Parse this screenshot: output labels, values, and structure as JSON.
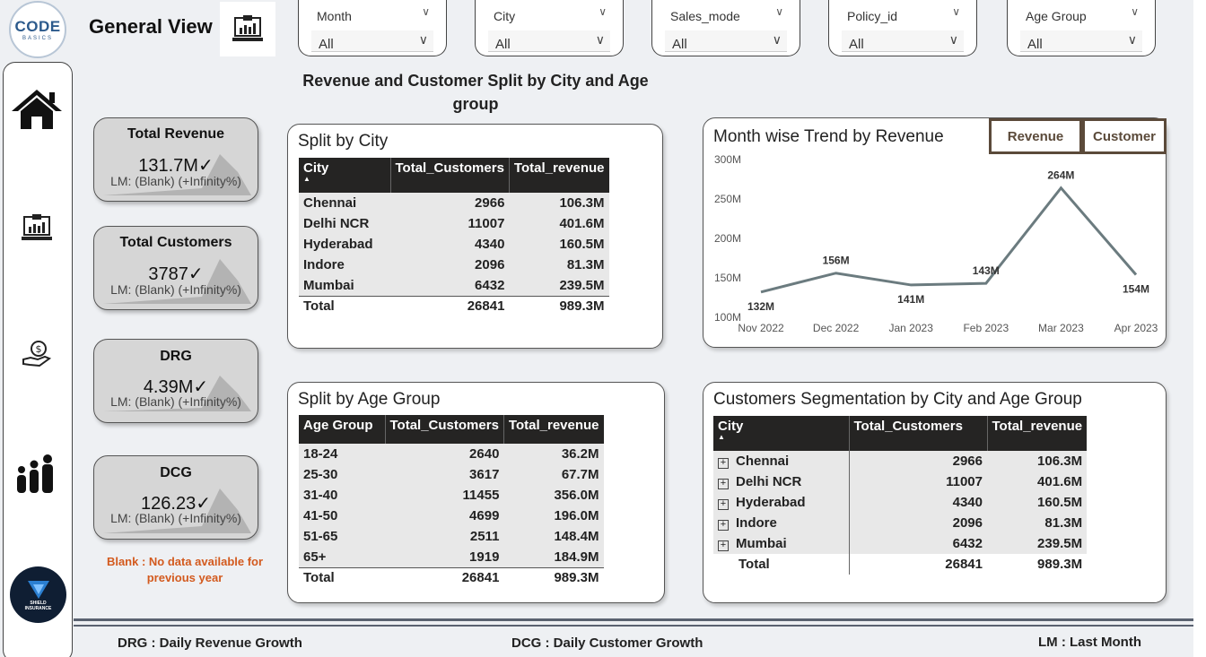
{
  "header": {
    "logo_main": "CODE",
    "logo_sub": "BASICS",
    "title": "General View",
    "kpi_icon": "kpi-report-icon",
    "slicers": [
      {
        "label": "Month",
        "value": "All"
      },
      {
        "label": "City",
        "value": "All"
      },
      {
        "label": "Sales_mode",
        "value": "All"
      },
      {
        "label": "Policy_id",
        "value": "All"
      },
      {
        "label": "Age Group",
        "value": "All"
      }
    ]
  },
  "sidenav": {
    "items": [
      {
        "name": "home-icon"
      },
      {
        "name": "kpi-report-icon"
      },
      {
        "name": "money-hand-icon"
      },
      {
        "name": "family-icon"
      }
    ],
    "brand": "SHIELD INSURANCE"
  },
  "kpis": [
    {
      "title": "Total Revenue",
      "value": "131.7M",
      "sub": "LM: (Blank) (+Infinity%)"
    },
    {
      "title": "Total Customers",
      "value": "3787",
      "sub": "LM: (Blank) (+Infinity%)"
    },
    {
      "title": "DRG",
      "value": "4.39M",
      "sub": "LM: (Blank) (+Infinity%)"
    },
    {
      "title": "DCG",
      "value": "126.23",
      "sub": "LM: (Blank) (+Infinity%)"
    }
  ],
  "blank_note": "Blank : No data available for previous year",
  "section_title": "Revenue and Customer Split by City and Age group",
  "city_split": {
    "title": "Split by City",
    "headers": [
      "City",
      "Total_Customers",
      "Total_revenue"
    ],
    "rows": [
      [
        "Chennai",
        "2966",
        "106.3M"
      ],
      [
        "Delhi NCR",
        "11007",
        "401.6M"
      ],
      [
        "Hyderabad",
        "4340",
        "160.5M"
      ],
      [
        "Indore",
        "2096",
        "81.3M"
      ],
      [
        "Mumbai",
        "6432",
        "239.5M"
      ]
    ],
    "total": [
      "Total",
      "26841",
      "989.3M"
    ]
  },
  "age_split": {
    "title": "Split by Age Group",
    "headers": [
      "Age Group",
      "Total_Customers",
      "Total_revenue"
    ],
    "rows": [
      [
        "18-24",
        "2640",
        "36.2M"
      ],
      [
        "25-30",
        "3617",
        "67.7M"
      ],
      [
        "31-40",
        "11455",
        "356.0M"
      ],
      [
        "41-50",
        "4699",
        "196.0M"
      ],
      [
        "51-65",
        "2511",
        "148.4M"
      ],
      [
        "65+",
        "1919",
        "184.9M"
      ]
    ],
    "total": [
      "Total",
      "26841",
      "989.3M"
    ]
  },
  "segmentation": {
    "title": "Customers Segmentation by City and Age Group",
    "headers": [
      "City",
      "Total_Customers",
      "Total_revenue"
    ],
    "rows": [
      [
        "Chennai",
        "2966",
        "106.3M"
      ],
      [
        "Delhi NCR",
        "11007",
        "401.6M"
      ],
      [
        "Hyderabad",
        "4340",
        "160.5M"
      ],
      [
        "Indore",
        "2096",
        "81.3M"
      ],
      [
        "Mumbai",
        "6432",
        "239.5M"
      ]
    ],
    "total": [
      "Total",
      "26841",
      "989.3M"
    ]
  },
  "trend": {
    "toggles": [
      "Revenue",
      "Customer"
    ]
  },
  "chart_data": {
    "type": "line",
    "title": "Month wise Trend by Revenue",
    "categories": [
      "Nov 2022",
      "Dec 2022",
      "Jan 2023",
      "Feb 2023",
      "Mar 2023",
      "Apr 2023"
    ],
    "values": [
      132,
      156,
      141,
      143,
      264,
      154
    ],
    "data_labels": [
      "132M",
      "156M",
      "141M",
      "143M",
      "264M",
      "154M"
    ],
    "yticks": [
      100,
      150,
      200,
      250,
      300
    ],
    "ytick_labels": [
      "100M",
      "150M",
      "200M",
      "250M",
      "300M"
    ],
    "ylim": [
      100,
      300
    ],
    "line_color": "#6b7b7f",
    "grid": false
  },
  "footer": {
    "drg": "DRG : Daily Revenue Growth",
    "dcg": "DCG : Daily Customer Growth",
    "lm": "LM : Last Month"
  },
  "colors": {
    "header_dark": "#252423",
    "note": "#d35a1e",
    "toggle": "#5b4a3a"
  }
}
